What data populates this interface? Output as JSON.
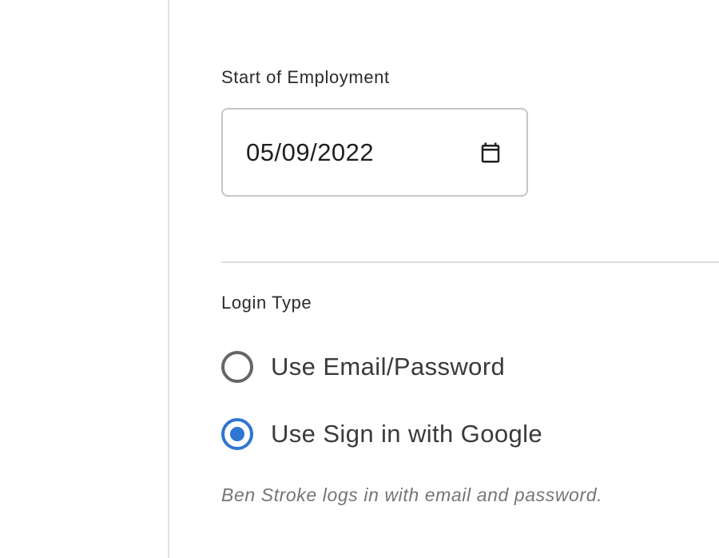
{
  "employment": {
    "start_label": "Start of Employment",
    "start_date_value": "05/09/2022"
  },
  "login": {
    "type_label": "Login Type",
    "options": [
      {
        "label": "Use Email/Password",
        "selected": false
      },
      {
        "label": "Use Sign in with Google",
        "selected": true
      }
    ],
    "helper_text": "Ben Stroke logs in with email and password."
  },
  "icons": {
    "calendar": "calendar-icon"
  },
  "colors": {
    "accent": "#2f76d2",
    "radio_unchecked": "#666666",
    "helper_text": "#757575",
    "divider": "#dedede"
  }
}
